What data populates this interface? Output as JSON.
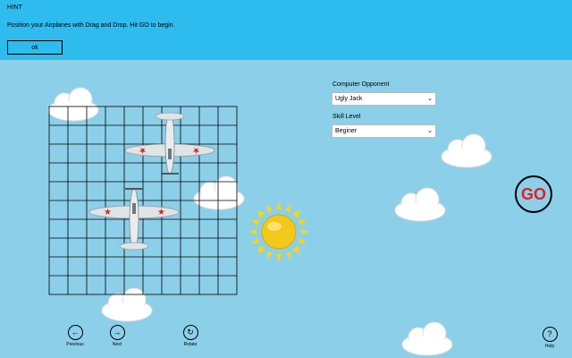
{
  "hint": {
    "title": "HINT",
    "message": "Position your Airplanes with Drag and Drop. Hit GO to begin.",
    "ok_label": "ok"
  },
  "controls": {
    "opponent_label": "Computer Opponent",
    "opponent_value": "Ugly Jack",
    "skill_label": "Skill Level",
    "skill_value": "Beginer",
    "go_label": "GO"
  },
  "nav": {
    "previous_label": "Previous",
    "next_label": "Next",
    "rotate_label": "Rotate",
    "help_label": "Help",
    "previous_icon": "arrow-left-icon",
    "next_icon": "arrow-right-icon",
    "rotate_icon": "rotate-icon",
    "help_icon": "question-icon"
  },
  "board": {
    "columns": 10,
    "rows": 10,
    "airplanes": 2
  },
  "colors": {
    "sky": "#8ccfe9",
    "banner": "#2ebcef",
    "go_text": "#e02020",
    "star": "#d8262b"
  }
}
